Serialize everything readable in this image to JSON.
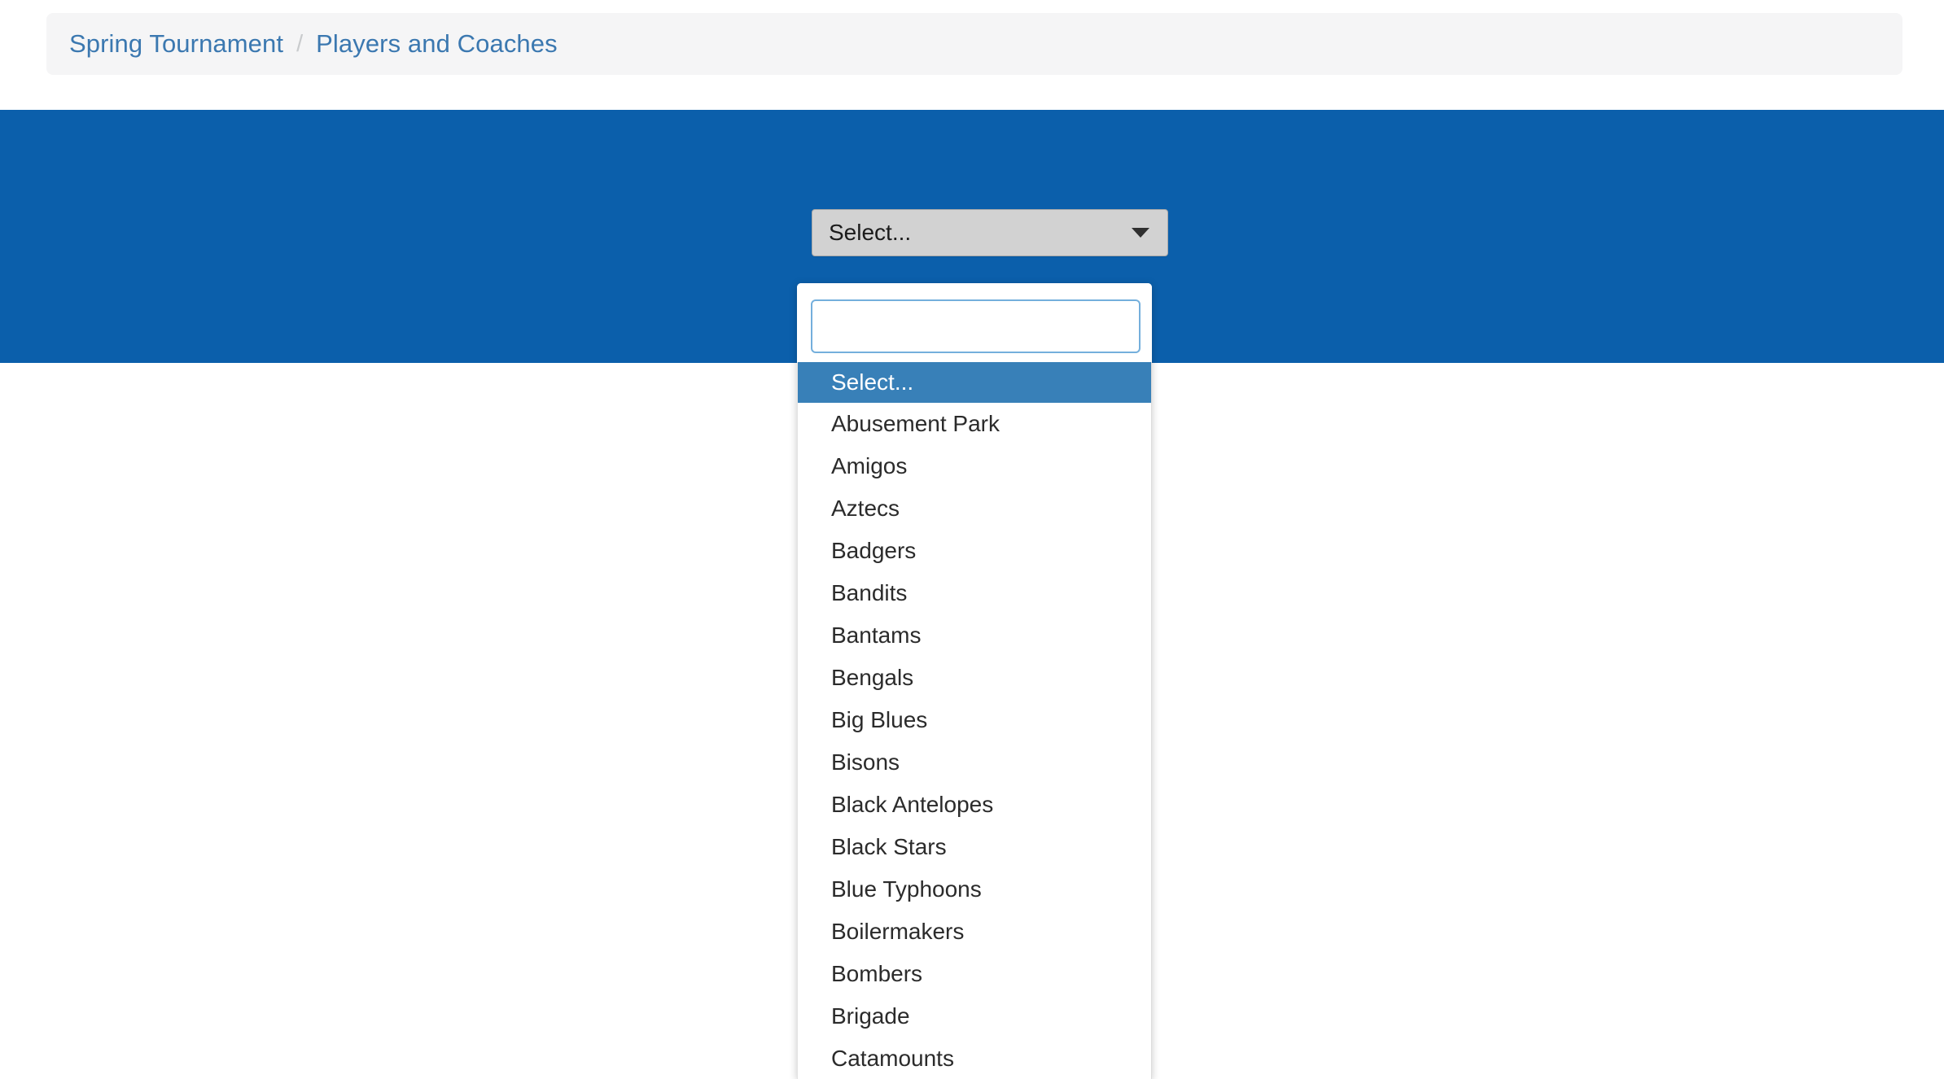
{
  "breadcrumb": {
    "items": [
      {
        "label": "Spring Tournament"
      },
      {
        "label": "Players and Coaches"
      }
    ],
    "separator": "/"
  },
  "banner": {
    "color": "#0b5fab"
  },
  "select": {
    "button_label": "Select...",
    "caret_icon": "chevron-down-icon",
    "search_value": "",
    "search_placeholder": "",
    "selected_option": "Select...",
    "accent_color": "#3880b8",
    "options": [
      "Select...",
      "Abusement Park",
      "Amigos",
      "Aztecs",
      "Badgers",
      "Bandits",
      "Bantams",
      "Bengals",
      "Big Blues",
      "Bisons",
      "Black Antelopes",
      "Black Stars",
      "Blue Typhoons",
      "Boilermakers",
      "Bombers",
      "Brigade",
      "Catamounts"
    ]
  }
}
